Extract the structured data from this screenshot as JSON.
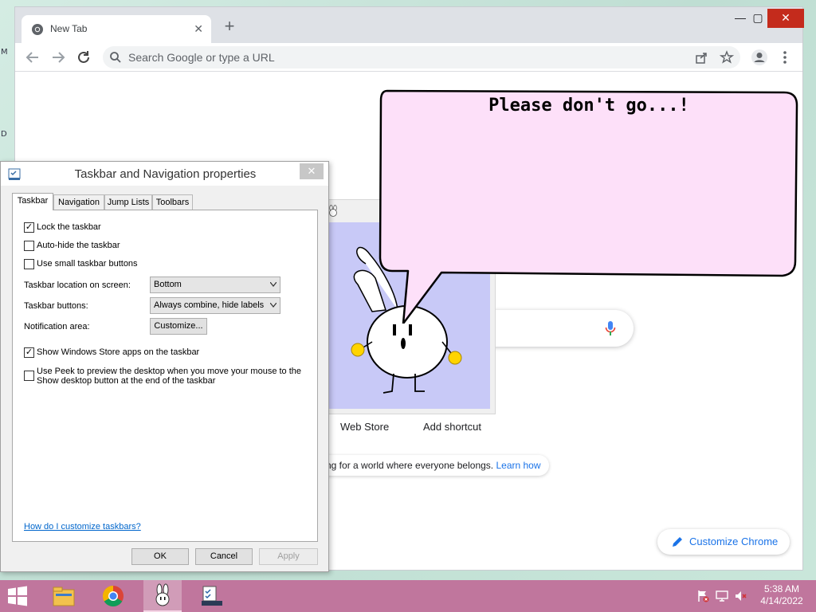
{
  "desktop": {
    "fragments": [
      "M",
      "D"
    ]
  },
  "browser": {
    "tab_title": "New Tab",
    "tab_close": "✕",
    "new_tab": "+",
    "window_controls": {
      "minimize": "—",
      "maximize": "▢",
      "close": "✕"
    },
    "omnibox_placeholder": "Search Google or type a URL",
    "shortcuts": [
      "Web Store",
      "Add shortcut"
    ],
    "promo_text": "ng for a world where everyone belongs.",
    "promo_link": "Learn how",
    "customize_label": "Customize Chrome"
  },
  "bubble": {
    "text": "Please don't go...!",
    "fill": "#fde0f9"
  },
  "dialog": {
    "title": "Taskbar and Navigation properties",
    "close": "✕",
    "tabs": [
      "Taskbar",
      "Navigation",
      "Jump Lists",
      "Toolbars"
    ],
    "active_tab": "Taskbar",
    "checkboxes": [
      {
        "label": "Lock the taskbar",
        "checked": true
      },
      {
        "label": "Auto-hide the taskbar",
        "checked": false
      },
      {
        "label": "Use small taskbar buttons",
        "checked": false
      }
    ],
    "location_label": "Taskbar location on screen:",
    "location_value": "Bottom",
    "buttons_label": "Taskbar buttons:",
    "buttons_value": "Always combine, hide labels",
    "notification_label": "Notification area:",
    "customize_button": "Customize...",
    "store_apps": {
      "label": "Show Windows Store apps on the taskbar",
      "checked": true
    },
    "peek": {
      "line1": "Use Peek to preview the desktop when you move your mouse to the",
      "line2": "Show desktop button at the end of the taskbar",
      "checked": false
    },
    "help_link": "How do I customize taskbars?",
    "ok": "OK",
    "cancel": "Cancel",
    "apply": "Apply"
  },
  "taskbar": {
    "color": "#c0769d",
    "apps": [
      "file-explorer-icon",
      "chrome-icon",
      "bunny-buddy-icon",
      "taskbar-properties-icon"
    ],
    "active_app": "bunny-buddy-icon",
    "tray": [
      "action-center-flag-icon",
      "network-icon",
      "volume-muted-icon"
    ],
    "time": "5:38 AM",
    "date": "4/14/2022"
  }
}
